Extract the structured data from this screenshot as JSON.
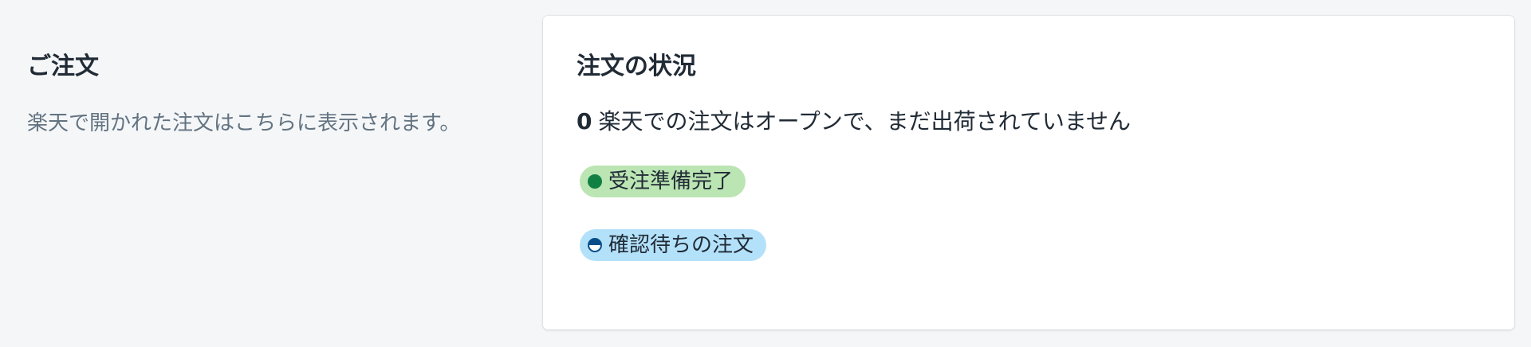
{
  "section": {
    "title": "ご注文",
    "description": "楽天で開かれた注文はこちらに表示されます。"
  },
  "card": {
    "title": "注文の状況",
    "open_count": "0",
    "open_text": "楽天での注文はオープンで、まだ出荷されていません",
    "badges": [
      {
        "label": "受注準備完了",
        "status": "success",
        "icon": "complete-dot-icon",
        "color": "#108043",
        "background": "#bbe5b3"
      },
      {
        "label": "確認待ちの注文",
        "status": "info",
        "icon": "partial-dot-icon",
        "color": "#084e8a",
        "background": "#b4e1fa"
      }
    ]
  }
}
